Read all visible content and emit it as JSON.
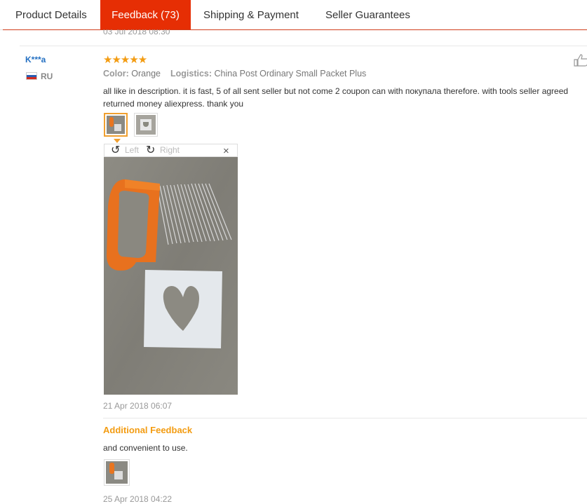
{
  "tabs": [
    {
      "label": "Product Details"
    },
    {
      "label": "Feedback (73)"
    },
    {
      "label": "Shipping & Payment"
    },
    {
      "label": "Seller Guarantees"
    }
  ],
  "previous_review_date": "03 Jul 2018 08:30",
  "review": {
    "user": "K***a",
    "country": "RU",
    "stars": "★★★★★",
    "color_label": "Color:",
    "color_value": "Orange",
    "logistics_label": "Logistics:",
    "logistics_value": "China Post Ordinary Small Packet Plus",
    "text_line1": "all like in description. it is fast, 5 of all sent seller but not come 2 coupon can with покупала therefore. with tools seller agreed",
    "text_line2": "returned money aliexpress. thank you",
    "viewer": {
      "left_label": "Left",
      "right_label": "Right",
      "close": "×"
    },
    "date": "21 Apr 2018 06:07",
    "additional": {
      "heading": "Additional Feedback",
      "text": "and convenient to use.",
      "date": "25 Apr 2018 04:22"
    }
  },
  "colors": {
    "accent": "#e62e04",
    "star": "#f39c12",
    "link": "#2470c2"
  },
  "icons": [
    "thumbs-up-icon",
    "rotate-left-icon",
    "rotate-right-icon",
    "close-icon",
    "russia-flag-icon"
  ]
}
